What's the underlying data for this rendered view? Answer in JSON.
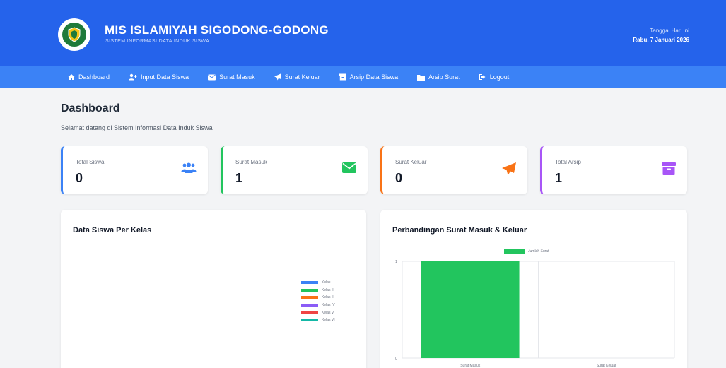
{
  "header": {
    "title": "MIS ISLAMIYAH SIGODONG-GODONG",
    "subtitle": "SISTEM INFORMASI DATA INDUK SISWA",
    "date_label": "Tanggal Hari Ini",
    "date_value": "Rabu, 7 Januari 2026",
    "logo_icon": "school-emblem-icon"
  },
  "nav": [
    {
      "label": "Dashboard",
      "icon": "home-icon"
    },
    {
      "label": "Input Data Siswa",
      "icon": "user-plus-icon"
    },
    {
      "label": "Surat Masuk",
      "icon": "envelope-icon"
    },
    {
      "label": "Surat Keluar",
      "icon": "paper-plane-icon"
    },
    {
      "label": "Arsip Data Siswa",
      "icon": "archive-icon"
    },
    {
      "label": "Arsip Surat",
      "icon": "folder-icon"
    },
    {
      "label": "Logout",
      "icon": "logout-icon"
    }
  ],
  "page": {
    "title": "Dashboard",
    "subtitle": "Selamat datang di Sistem Informasi Data Induk Siswa"
  },
  "cards": [
    {
      "label": "Total Siswa",
      "value": "0",
      "icon": "users-icon",
      "color": "#3b82f6"
    },
    {
      "label": "Surat Masuk",
      "value": "1",
      "icon": "envelope-icon",
      "color": "#22c55e"
    },
    {
      "label": "Surat Keluar",
      "value": "0",
      "icon": "paper-plane-icon",
      "color": "#f97316"
    },
    {
      "label": "Total Arsip",
      "value": "1",
      "icon": "archive-icon",
      "color": "#a855f7"
    }
  ],
  "panels": {
    "siswa_title": "Data Siswa Per Kelas",
    "surat_title": "Perbandingan Surat Masuk & Keluar"
  },
  "chart_data": [
    {
      "type": "pie",
      "title": "Data Siswa Per Kelas",
      "legend": [
        {
          "label": "Kelas I",
          "color": "#3b82f6"
        },
        {
          "label": "Kelas II",
          "color": "#22c55e"
        },
        {
          "label": "Kelas III",
          "color": "#f97316"
        },
        {
          "label": "Kelas IV",
          "color": "#8b5cf6"
        },
        {
          "label": "Kelas V",
          "color": "#ef4444"
        },
        {
          "label": "Kelas VI",
          "color": "#14b8a6"
        }
      ],
      "values": [
        0,
        0,
        0,
        0,
        0,
        0
      ],
      "legend_position": "right"
    },
    {
      "type": "bar",
      "title": "Perbandingan Surat Masuk & Keluar",
      "categories": [
        "Surat Masuk",
        "Surat Keluar"
      ],
      "series": [
        {
          "name": "Jumlah Surat",
          "values": [
            1,
            0
          ],
          "color": "#22c55e"
        }
      ],
      "ylim": [
        0,
        1
      ],
      "yticks": [
        "0",
        "1"
      ],
      "grid": true,
      "legend_position": "top"
    }
  ]
}
